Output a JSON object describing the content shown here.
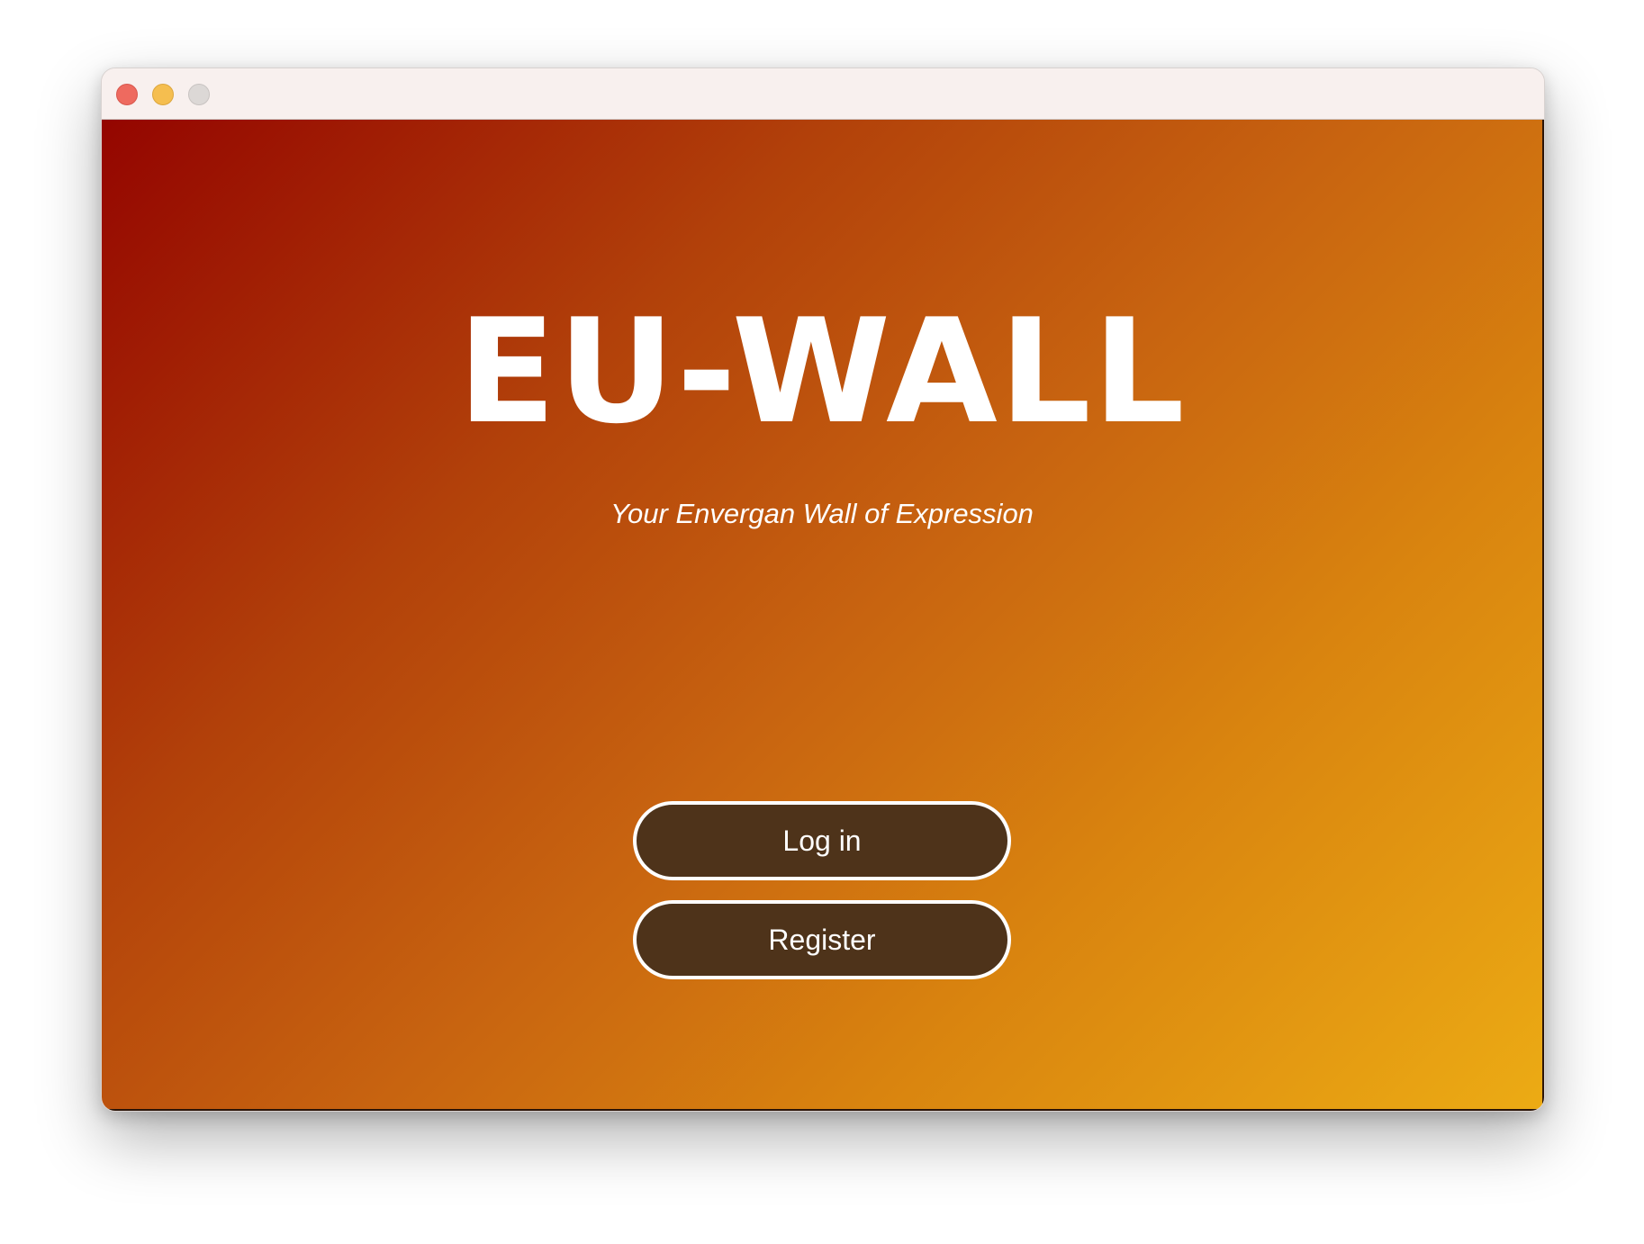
{
  "app": {
    "title": "EU-WALL",
    "subtitle": "Your Envergan Wall of Expression"
  },
  "actions": {
    "login_label": "Log in",
    "register_label": "Register"
  },
  "window_controls": {
    "close": "close-icon",
    "minimize": "minimize-icon",
    "maximize": "maximize-icon"
  },
  "colors": {
    "gradient_start": "#940500",
    "gradient_end": "#ecab14",
    "button_fill": "#4e331a",
    "button_border": "#ffffff",
    "text": "#ffffff"
  }
}
